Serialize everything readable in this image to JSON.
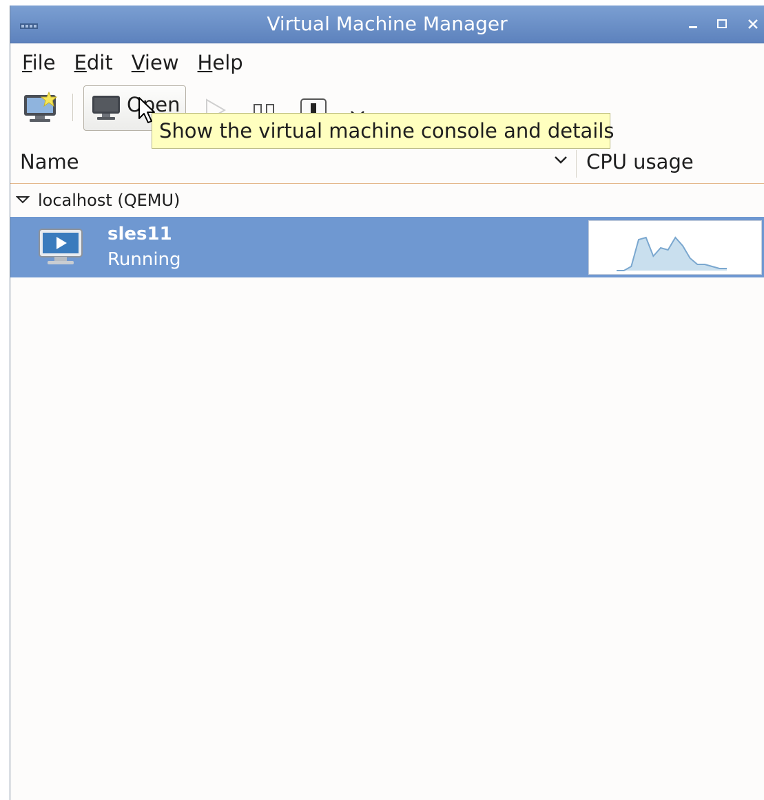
{
  "window": {
    "title": "Virtual Machine Manager",
    "controls": [
      "minimize",
      "maximize",
      "close"
    ]
  },
  "menubar": {
    "items": [
      {
        "mnemonic": "F",
        "rest": "ile"
      },
      {
        "mnemonic": "E",
        "rest": "dit"
      },
      {
        "mnemonic": "V",
        "rest": "iew"
      },
      {
        "mnemonic": "H",
        "rest": "elp"
      }
    ]
  },
  "toolbar": {
    "open_label": "Open",
    "icons": [
      "new-vm-icon",
      "monitor-icon",
      "run-icon",
      "pause-icon",
      "shutdown-icon",
      "dropdown-arrow-icon"
    ]
  },
  "tooltip": {
    "text": "Show the virtual machine console and details"
  },
  "columns": {
    "name": "Name",
    "cpu": "CPU usage"
  },
  "connection": {
    "label": "localhost (QEMU)"
  },
  "vms": [
    {
      "name": "sles11",
      "state": "Running",
      "cpu_history": [
        0,
        0,
        0.1,
        0.75,
        0.8,
        0.35,
        0.55,
        0.5,
        0.8,
        0.6,
        0.3,
        0.15,
        0.15,
        0.1,
        0.05,
        0.05
      ]
    }
  ],
  "colors": {
    "titlebar": "#6d91c9",
    "selection": "#6f98d1",
    "tooltip_bg": "#ffffbf",
    "graph_line": "#7aa7cf",
    "graph_fill": "#c9dfee"
  }
}
